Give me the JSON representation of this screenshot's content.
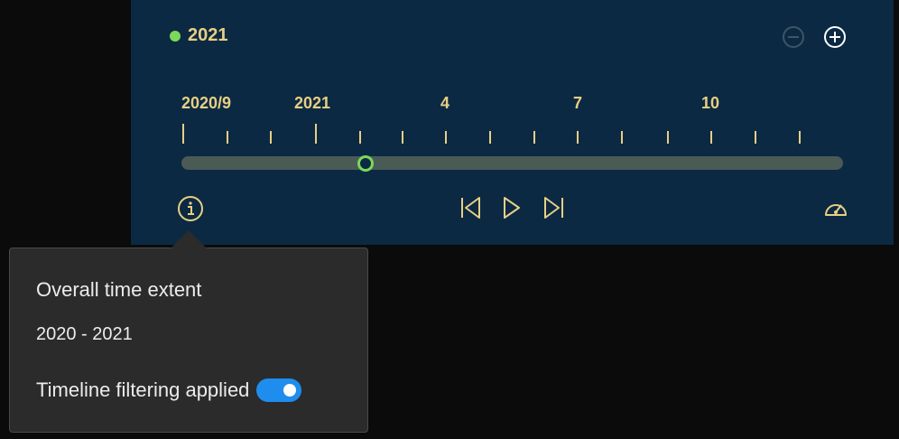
{
  "timeline": {
    "current_date": "2021",
    "tick_labels": [
      "2020/9",
      "2021",
      "4",
      "7",
      "10"
    ],
    "slider_position": 0.28,
    "colors": {
      "panel_bg": "#0b2942",
      "accent": "#e8cf84",
      "active": "#7bd85a",
      "track": "#4a5b56"
    },
    "icons": {
      "zoom_out": "minus-circle-icon",
      "zoom_in": "plus-circle-icon",
      "info": "info-icon",
      "previous": "skip-back-icon",
      "play": "play-icon",
      "next": "skip-forward-icon",
      "speed": "speedometer-icon"
    }
  },
  "popover": {
    "title": "Overall time extent",
    "range": "2020 - 2021",
    "filter_label": "Timeline filtering applied",
    "filter_enabled": true,
    "colors": {
      "bg": "#2b2b2b",
      "toggle_on": "#1f8ded"
    }
  }
}
